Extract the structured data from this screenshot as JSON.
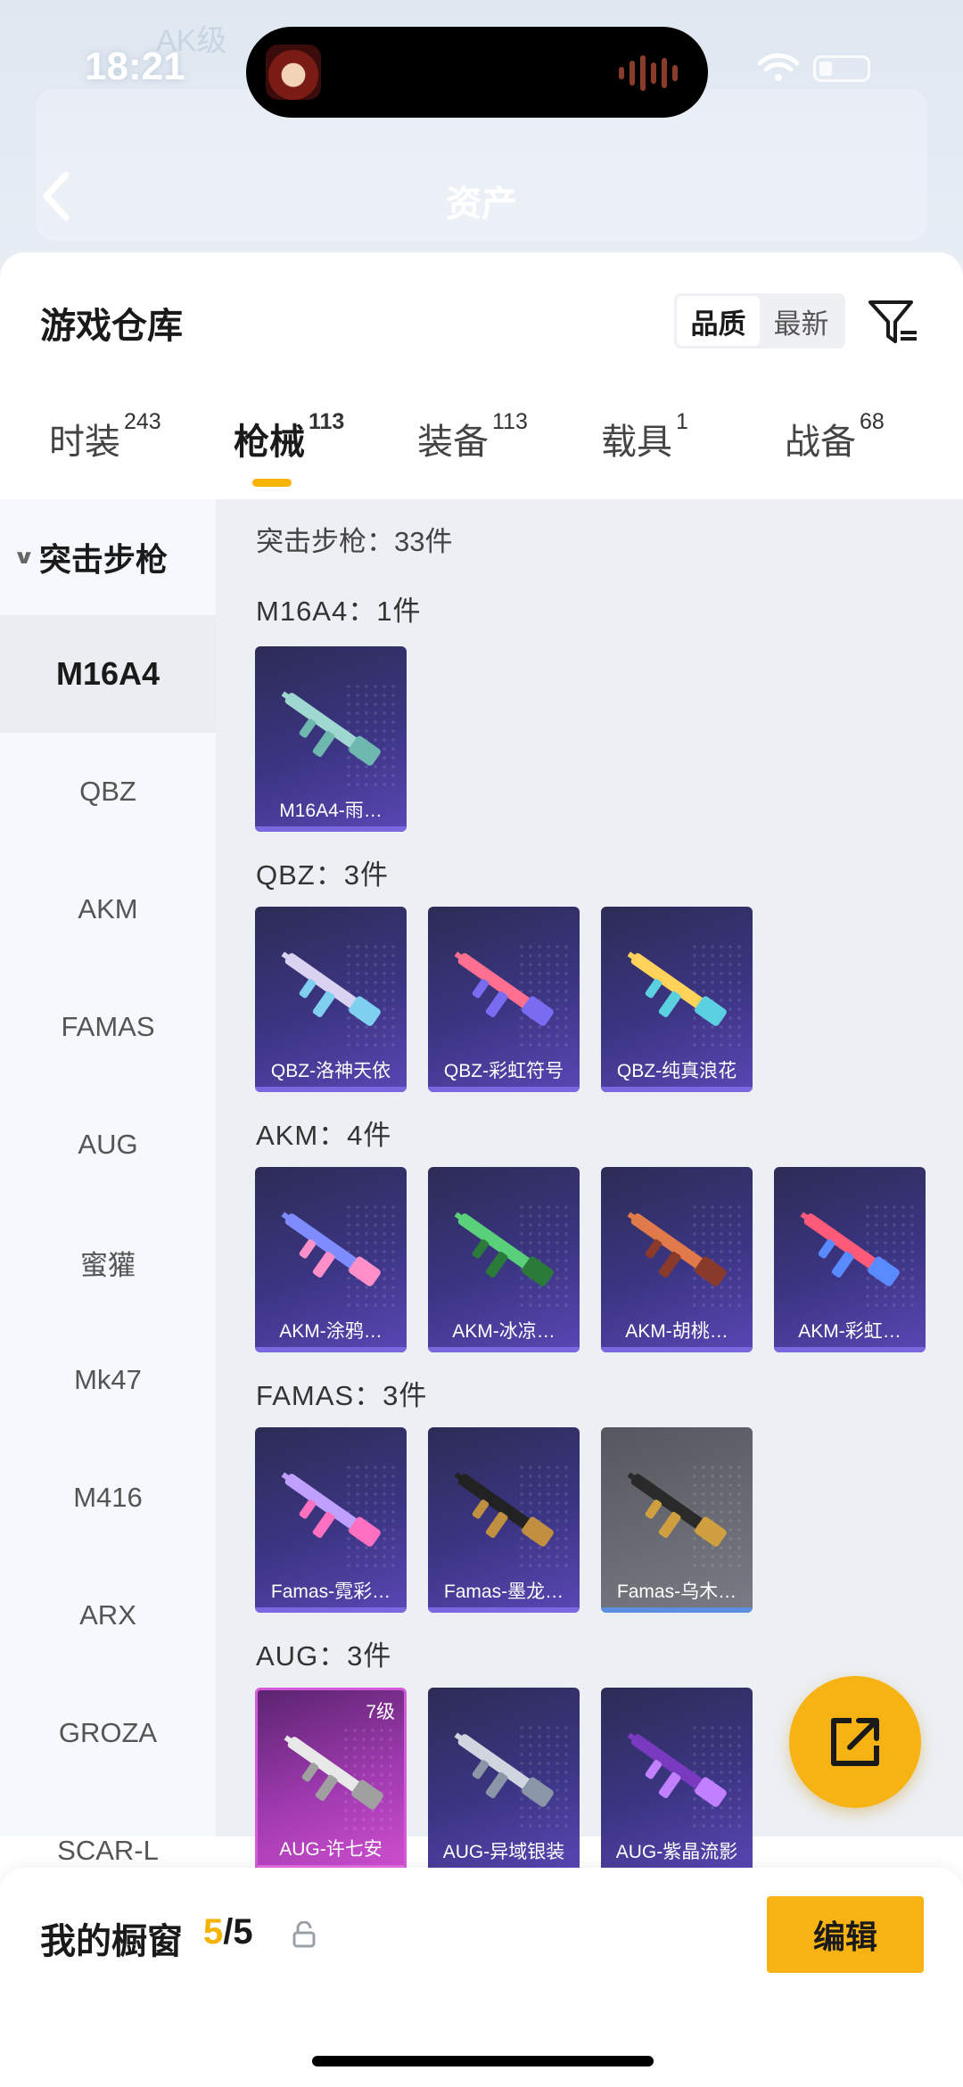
{
  "status": {
    "time": "18:21",
    "bg_level": "AK级"
  },
  "header": {
    "title_ghost": "资产"
  },
  "warehouse": {
    "title": "游戏仓库",
    "sort": {
      "quality": "品质",
      "latest": "最新"
    }
  },
  "tabs": [
    {
      "label": "时装",
      "count": "243"
    },
    {
      "label": "枪械",
      "count": "113"
    },
    {
      "label": "装备",
      "count": "113"
    },
    {
      "label": "载具",
      "count": "1"
    },
    {
      "label": "战备",
      "count": "68"
    }
  ],
  "sidebar": {
    "header": "突击步枪",
    "items": [
      "M16A4",
      "QBZ",
      "AKM",
      "FAMAS",
      "AUG",
      "蜜獾",
      "Mk47",
      "M416",
      "ARX",
      "GROZA",
      "SCAR-L"
    ]
  },
  "content": {
    "count_line": "突击步枪：33件",
    "groups": [
      {
        "title": "M16A4：1件",
        "items": [
          {
            "label": "M16A4-雨…"
          }
        ]
      },
      {
        "title": "QBZ：3件",
        "items": [
          {
            "label": "QBZ-洛神天依"
          },
          {
            "label": "QBZ-彩虹符号"
          },
          {
            "label": "QBZ-纯真浪花"
          }
        ]
      },
      {
        "title": "AKM：4件",
        "items": [
          {
            "label": "AKM-涂鸦…"
          },
          {
            "label": "AKM-冰凉…"
          },
          {
            "label": "AKM-胡桃…"
          },
          {
            "label": "AKM-彩虹…"
          }
        ]
      },
      {
        "title": "FAMAS：3件",
        "items": [
          {
            "label": "Famas-霓彩…"
          },
          {
            "label": "Famas-墨龙…"
          },
          {
            "label": "Famas-乌木…"
          }
        ]
      },
      {
        "title": "AUG：3件",
        "items": [
          {
            "label": "AUG-许七安",
            "badge": "7级"
          },
          {
            "label": "AUG-异域银装"
          },
          {
            "label": "AUG-紫晶流影"
          }
        ]
      }
    ]
  },
  "bottom": {
    "window_label": "我的橱窗",
    "window_current": "5",
    "window_total": "/5",
    "edit_label": "编辑"
  },
  "colors": {
    "accent": "#f7b313",
    "card_purple": "#3c3584",
    "card_pink": "#a03ab0",
    "card_grey": "#6b6d75"
  },
  "icons": [
    "back-icon",
    "filter-icon",
    "chevron-down-icon",
    "share-icon",
    "lock-icon",
    "wifi-icon",
    "battery-icon"
  ]
}
